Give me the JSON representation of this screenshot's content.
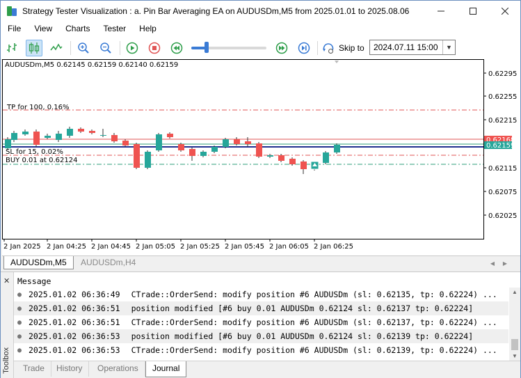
{
  "window": {
    "title": "Strategy Tester Visualization : a. Pin Bar Averaging EA on AUDUSDm,M5 from 2025.01.01 to 2025.08.06",
    "controls": [
      "minimize",
      "maximize",
      "close"
    ]
  },
  "menu": [
    "File",
    "View",
    "Charts",
    "Tester",
    "Help"
  ],
  "toolbar": {
    "buttons": [
      "bar-chart",
      "candlestick-chart",
      "line-chart",
      "zoom-in",
      "zoom-out",
      "play",
      "stop",
      "rewind",
      "fast-forward",
      "step-forward"
    ],
    "skip_to_label": "Skip to",
    "skip_to_value": "2024.07.11 15:00",
    "speed_level": 0.2
  },
  "chart": {
    "info": "AUDUSDm,M5  0.62145 0.62159 0.62140 0.62159",
    "price_labels": [
      "0.62295",
      "0.62255",
      "0.62215",
      "0.62175",
      "0.62155",
      "0.62115",
      "0.62075",
      "0.62025"
    ],
    "time_labels": [
      "2 Jan 2025",
      "2 Jan 04:25",
      "2 Jan 04:45",
      "2 Jan 05:05",
      "2 Jan 05:25",
      "2 Jan 05:45",
      "2 Jan 06:05",
      "2 Jan 06:25"
    ],
    "tp_label": "TP for 100, 0.16%",
    "sl_label": "SL for 15, 0.02%",
    "buy_label": "BUY 0.01 at 0.62124",
    "ask_tag": "0.62168",
    "bid_tag": "0.62159",
    "colors": {
      "bull": "#26a69a",
      "bear": "#ef5350",
      "tp": "#e05555",
      "buy": "#2e9e7a",
      "sl": "#1f2f8f"
    }
  },
  "chart_tabs": [
    "AUDUSDm,M5",
    "AUDUSDm,H4"
  ],
  "toolbox": {
    "label": "Toolbox",
    "column_header": "Message",
    "log": [
      {
        "time": "2025.01.02 06:36:49",
        "message": "CTrade::OrderSend: modify position #6 AUDUSDm (sl: 0.62135, tp: 0.62224) ..."
      },
      {
        "time": "2025.01.02 06:36:51",
        "message": "position modified [#6 buy 0.01 AUDUSDm 0.62124 sl: 0.62137 tp: 0.62224]"
      },
      {
        "time": "2025.01.02 06:36:51",
        "message": "CTrade::OrderSend: modify position #6 AUDUSDm (sl: 0.62137, tp: 0.62224) ..."
      },
      {
        "time": "2025.01.02 06:36:53",
        "message": "position modified [#6 buy 0.01 AUDUSDm 0.62124 sl: 0.62139 tp: 0.62224]"
      },
      {
        "time": "2025.01.02 06:36:53",
        "message": "CTrade::OrderSend: modify position #6 AUDUSDm (sl: 0.62139, tp: 0.62224) ..."
      }
    ],
    "tabs": [
      "Trade",
      "History",
      "Operations",
      "Journal"
    ],
    "active_tab": "Journal"
  }
}
